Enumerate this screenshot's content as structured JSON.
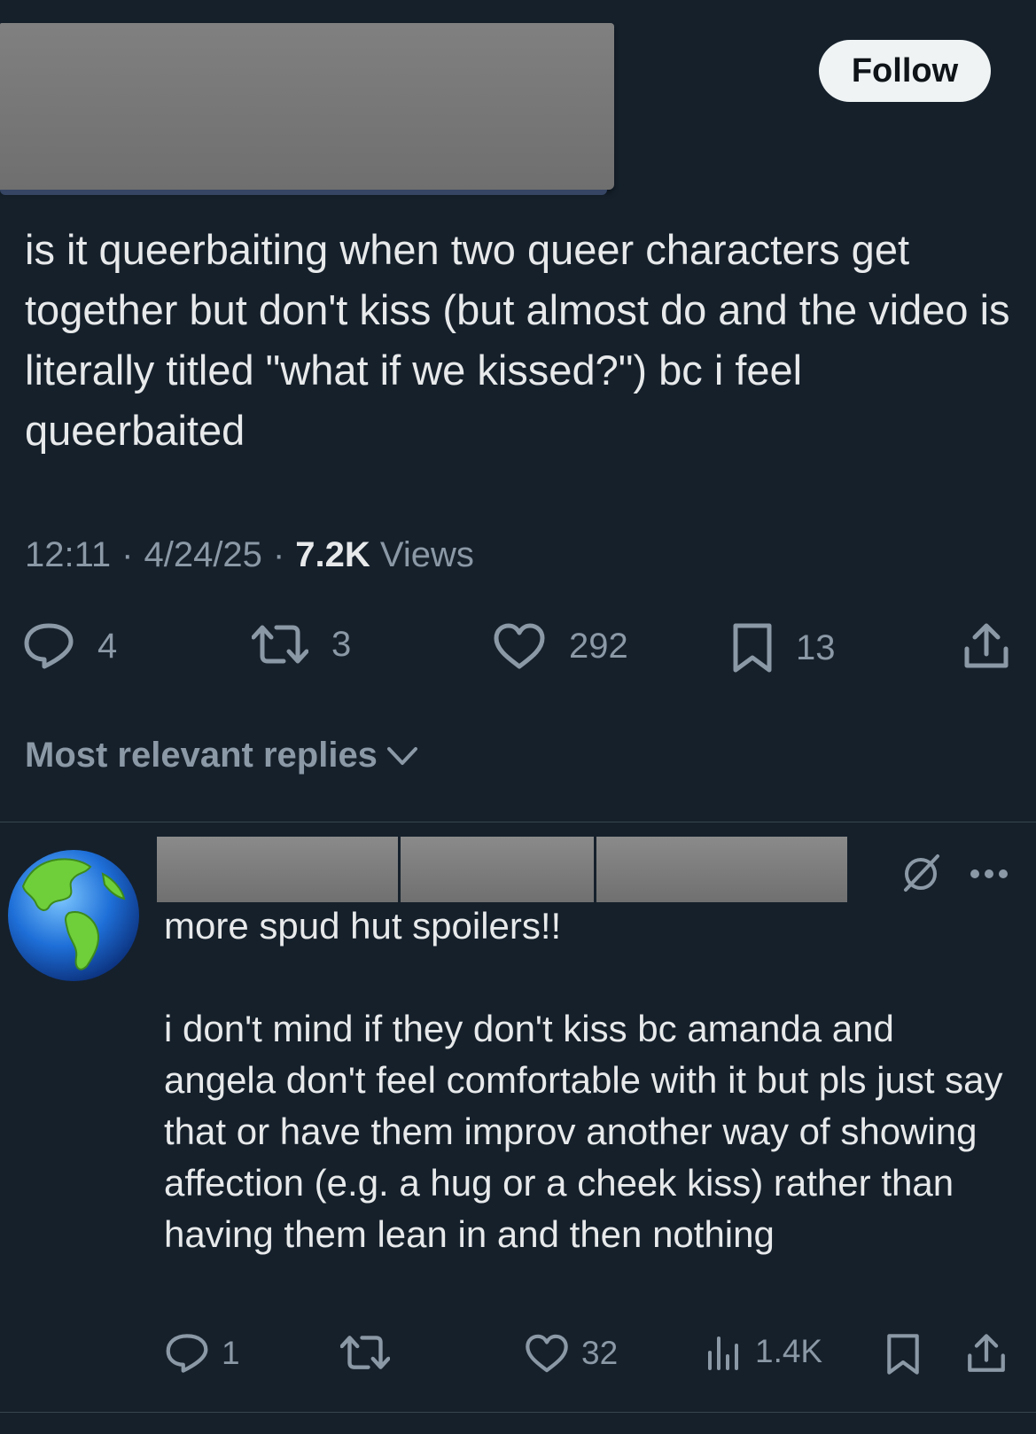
{
  "header": {
    "follow_label": "Follow"
  },
  "tweet": {
    "text": "is it queerbaiting when two queer characters get together but don't kiss (but almost do and the video is literally titled \"what if we kissed?\") bc i feel queerbaited",
    "time": "12:11",
    "date": "4/24/25",
    "views_count": "7.2K",
    "views_label": "Views",
    "replies": "4",
    "reposts": "3",
    "likes": "292",
    "bookmarks": "13"
  },
  "sort": {
    "label": "Most relevant replies"
  },
  "reply": {
    "line1": "more spud hut spoilers!!",
    "line2": "i don't mind if they don't kiss bc amanda and angela don't feel comfortable with it but pls just say that or have them improv another way of showing affection (e.g. a hug or a cheek kiss) rather than having them lean in and then nothing",
    "replies": "1",
    "likes": "32",
    "views": "1.4K"
  },
  "colors": {
    "background": "#15202b",
    "text": "#e7e9ea",
    "muted": "#8b98a5",
    "divider": "#38444d"
  },
  "icons": [
    "reply-icon",
    "repost-icon",
    "like-icon",
    "bookmark-icon",
    "share-icon",
    "views-icon",
    "grok-icon",
    "more-icon",
    "chevron-down-icon",
    "globe-avatar"
  ]
}
